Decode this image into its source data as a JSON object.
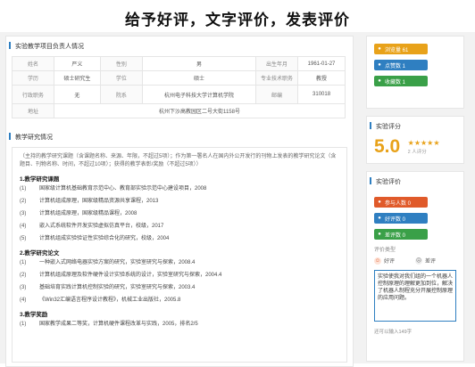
{
  "banner": {
    "title": "给予好评，文字评价，发表评价"
  },
  "applicant": {
    "section_title": "实验教学项目负责人情况",
    "rows": [
      [
        "姓名",
        "严义",
        "性别",
        "男",
        "出生年月",
        "1961-01-27"
      ],
      [
        "学历",
        "硕士研究生",
        "学位",
        "硕士",
        "专业技术职务",
        "教授"
      ],
      [
        "行政职务",
        "无",
        "院系",
        "杭州电子科技大学计算机学院",
        "邮编",
        "310018"
      ]
    ],
    "address_label": "地址",
    "address_value": "杭州下沙高教园区二号大街1158号"
  },
  "research": {
    "section_title": "教学研究情况",
    "intro": "（主持的教学研究课题（含课题名称、来源、年限，不超过5项）；作为第一署名人在国内外公开发行的刊物上发表的教学研究论文（含题目、刊物名称、时间，不超过10项）；获得的教学表彰/奖励（不超过5项））",
    "groups": [
      {
        "heading": "1.教学研究课题",
        "items": [
          {
            "n": "(1)",
            "t": "国家级计算机基础教育示范中心、教育部实验示范中心建设项目，2008"
          },
          {
            "n": "(2)",
            "t": "计算机组成原理，国家级精品资源共享课程，2013"
          },
          {
            "n": "(3)",
            "t": "计算机组成原理，国家级精品课程，2008"
          },
          {
            "n": "(4)",
            "t": "嵌入式系统软件开发实验虚拟仿真平台，校级，2017"
          },
          {
            "n": "(5)",
            "t": "计算机组成实验验证性实验综合化的研究，校级，2004"
          }
        ]
      },
      {
        "heading": "2.教学研究论文",
        "items": [
          {
            "n": "(1)",
            "t": "一种嵌入式网络电器实验方案的研究，实验室研究与探索，2008.4"
          },
          {
            "n": "(2)",
            "t": "计算机组成原理及软件硬件设计实验系统的设计，实验室研究与探索，2004.4"
          },
          {
            "n": "(3)",
            "t": "基础培育实践计算机控制实验的研究，实验室研究与探索，2003.4"
          },
          {
            "n": "(4)",
            "t": "《Win32汇编语言程序设计教程》，机械工业出版社，2005.8"
          }
        ]
      },
      {
        "heading": "3.教学奖励",
        "items": [
          {
            "n": "(1)",
            "t": "国家教学成果二等奖，计算机硬件课程改革与实践，2005，排名2/5"
          }
        ]
      }
    ]
  },
  "sidebar": {
    "stats": [
      {
        "label": "浏览量 61",
        "color": "#e8a21a",
        "icon": "eye-icon"
      },
      {
        "label": "点赞数 1",
        "color": "#2f7fc1",
        "icon": "thumb-icon"
      },
      {
        "label": "收藏数 1",
        "color": "#3aa048",
        "icon": "star-icon"
      }
    ],
    "score_title": "实验评分",
    "score_value": "5.0",
    "score_stars": "★★★★★",
    "score_count": "2 人评分",
    "review_title": "实验评价",
    "review_stats": [
      {
        "label": "参与人数 0",
        "color": "#e05a2a",
        "icon": "people-icon"
      },
      {
        "label": "好评数 0",
        "color": "#2f7fc1",
        "icon": "heart-icon"
      },
      {
        "label": "差评数 0",
        "color": "#3aa048",
        "icon": "thumbdown-icon"
      }
    ],
    "review_type_label": "评价类型",
    "type_good": "好评",
    "type_bad": "差评",
    "review_text": "实验使我对我们组的一个机器人控制原理的理解更加到位，解决了机器人制程充分开展控制原理的应用问题。",
    "remain_text": "还可以输入149字"
  }
}
